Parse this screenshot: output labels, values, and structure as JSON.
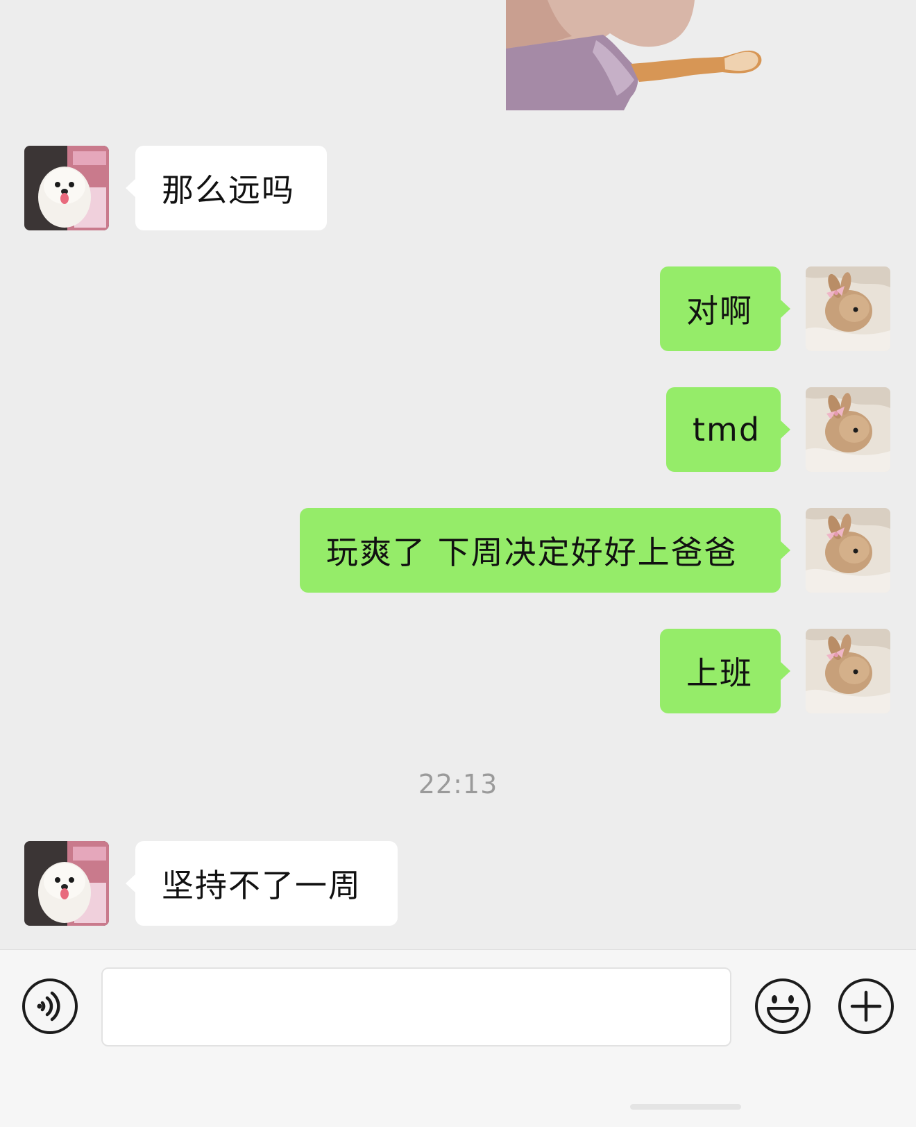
{
  "messages": {
    "incoming_1": "那么远吗",
    "outgoing_1": "对啊",
    "outgoing_2": "tmd",
    "outgoing_3": "玩爽了 下周决定好好上爸爸",
    "outgoing_4": "上班",
    "incoming_2": "坚持不了一周"
  },
  "timestamp": "22:13",
  "input": {
    "value": ""
  },
  "icons": {
    "voice": "voice-icon",
    "emoji": "emoji-icon",
    "plus": "plus-icon",
    "contact_avatar": "dog-avatar",
    "self_avatar": "rabbit-avatar"
  },
  "colors": {
    "background": "#ededed",
    "outgoing_bubble": "#95ec69",
    "incoming_bubble": "#ffffff",
    "timestamp": "#9a9a9a"
  }
}
